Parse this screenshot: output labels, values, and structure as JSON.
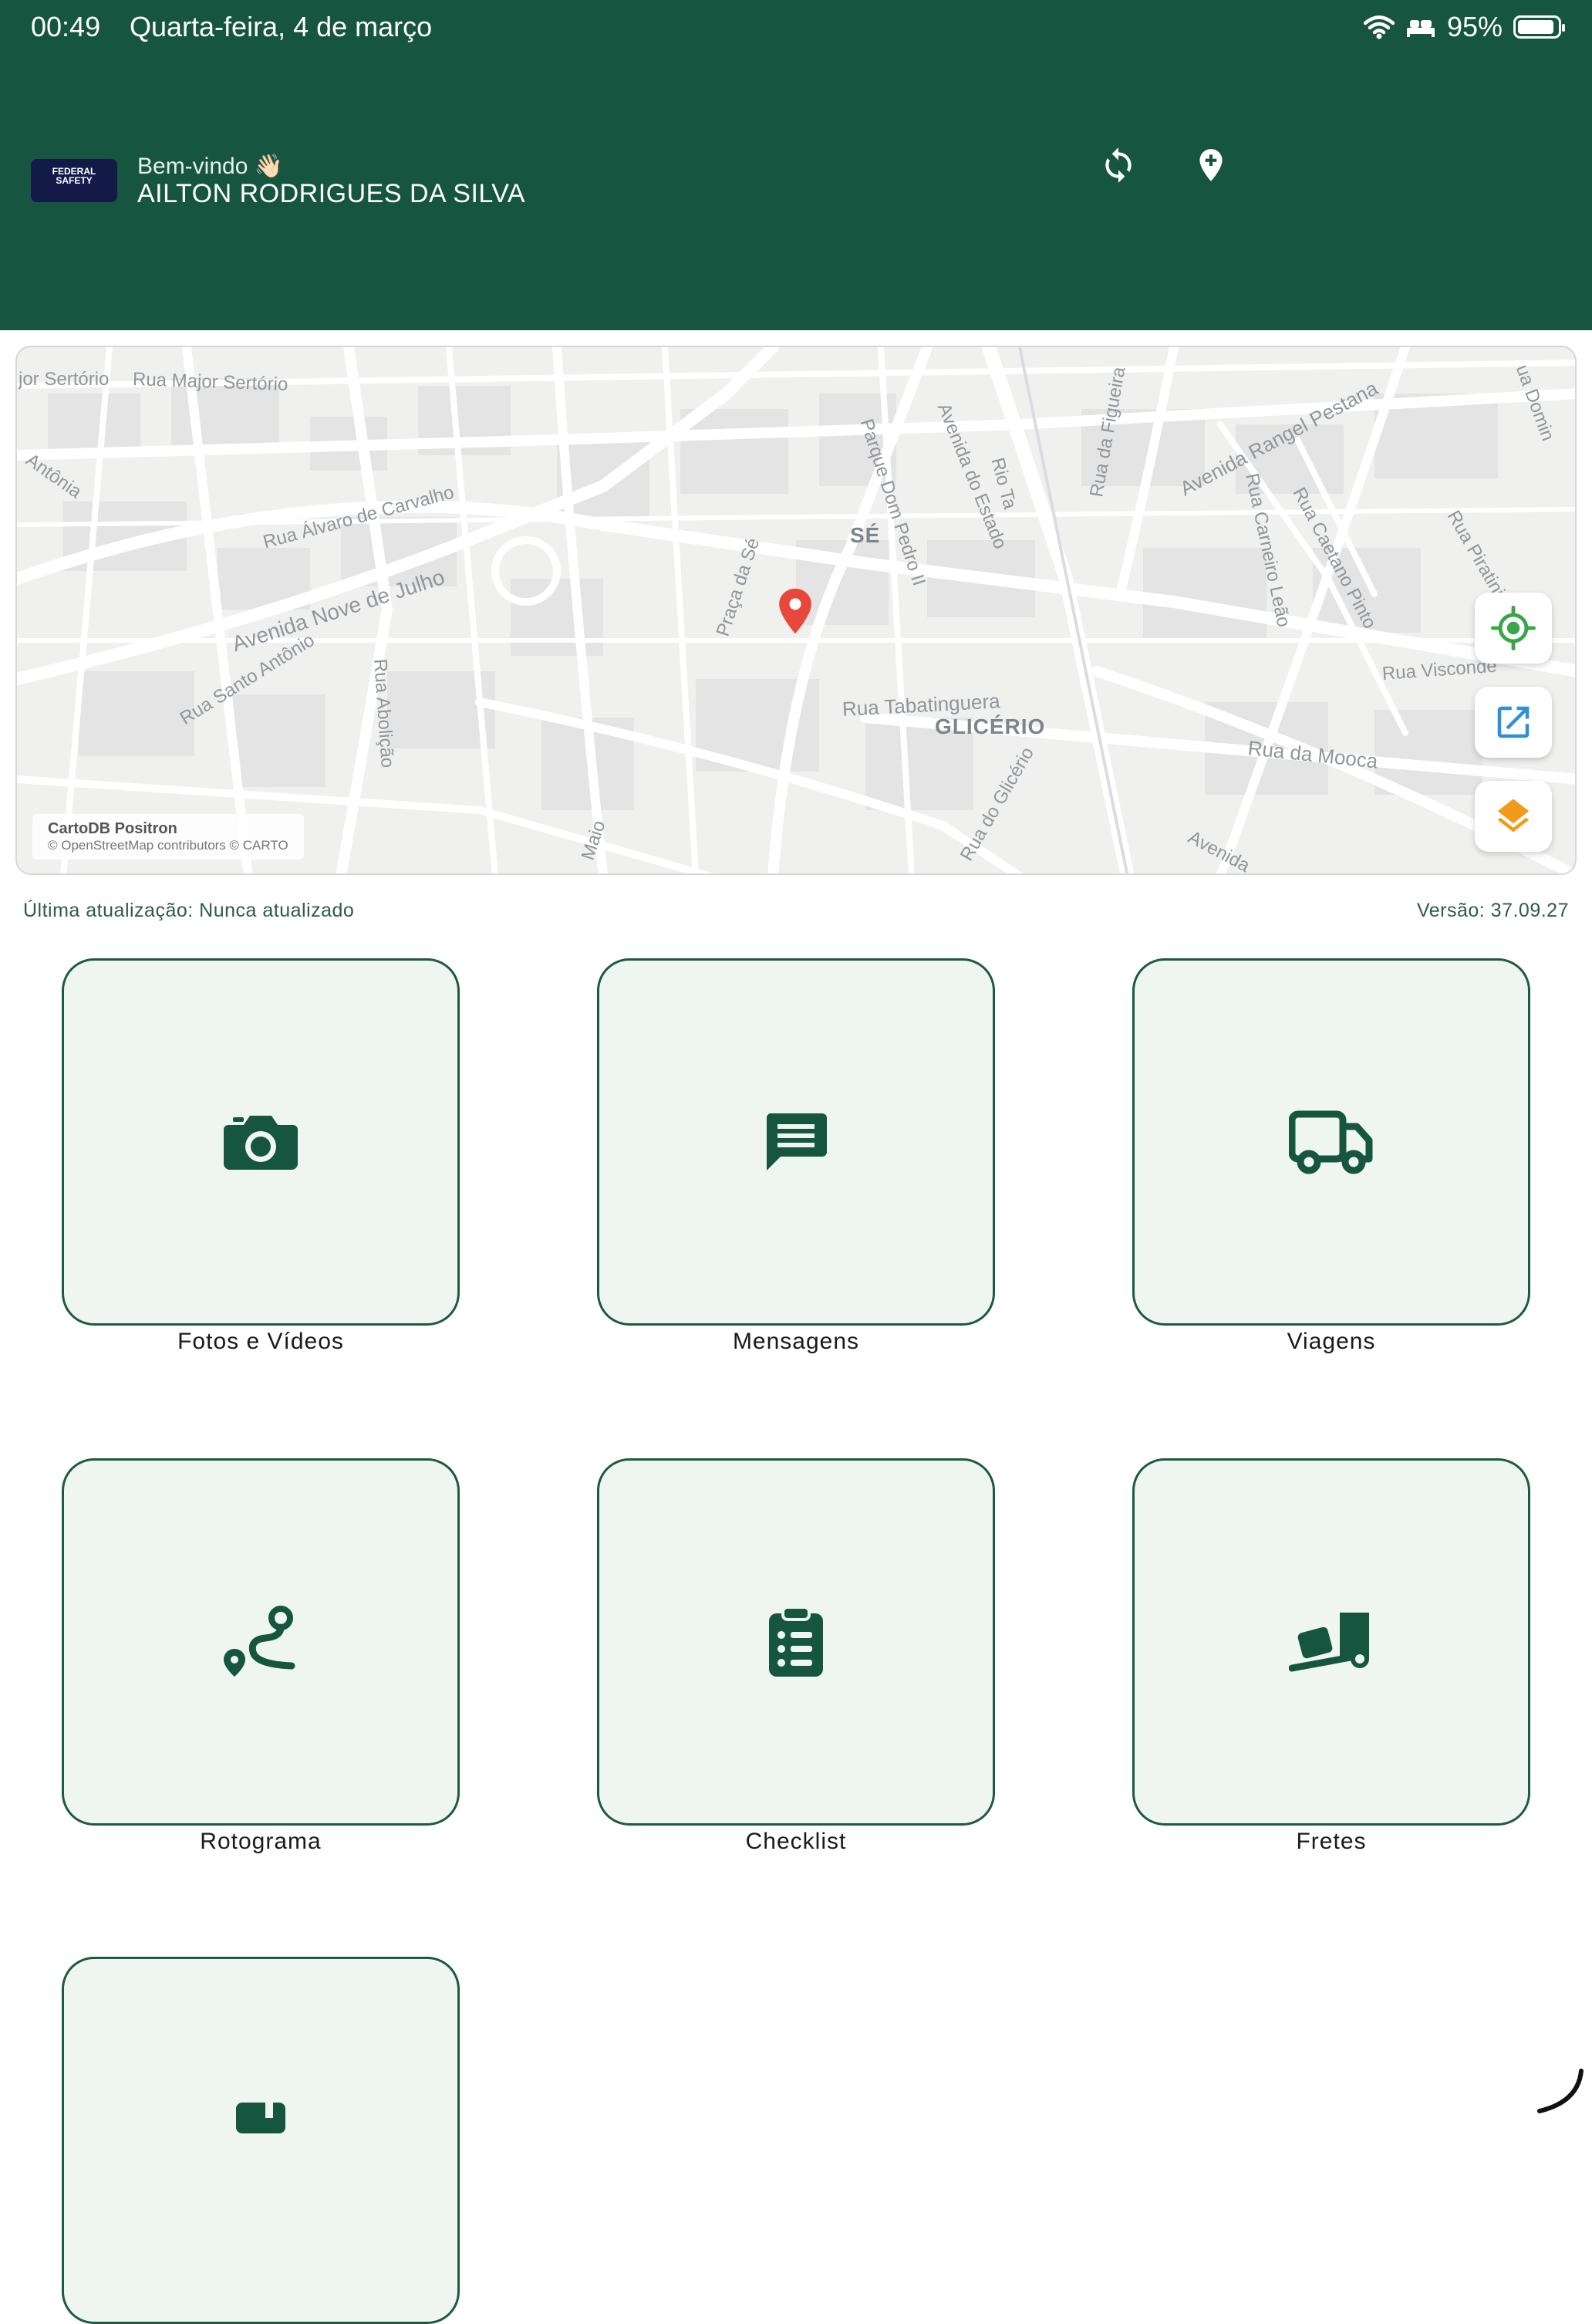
{
  "status_bar": {
    "time": "00:49",
    "date": "Quarta-feira, 4 de março",
    "battery": "95%",
    "battery_level": 0.95
  },
  "header": {
    "logo_text": "FEDERAL SAFETY",
    "greeting": "Bem-vindo 👋🏻",
    "user_name": "AILTON RODRIGUES DA SILVA",
    "actions": [
      {
        "name": "sync",
        "icon": "sync-icon"
      },
      {
        "name": "add-location",
        "icon": "add-location-icon"
      }
    ],
    "background_color": "#165540"
  },
  "map": {
    "streets": [
      "Rua Major Sertório",
      "jor Sertório",
      "Rua Álvaro de Carvalho",
      "Avenida Nove de Julho",
      "Rua Santo Antônio",
      "Rua Abolição",
      "Praça da Sé",
      "Parque Dom Pedro II",
      "Avenida do Estado",
      "Rio Ta",
      "Rua da Figueira",
      "Avenida Rangel Pestana",
      "Rua Carneiro Leão",
      "Rua Caetano Pinto",
      "Rua Piratini",
      "Rua Tabatinguera",
      "Rua da Mooca",
      "Rua Visconde",
      "Rua do Glicério",
      "Avenida",
      "Maio",
      "Antônia",
      "ua Domin"
    ],
    "districts": [
      "SÉ",
      "GLICÉRIO"
    ],
    "attribution_title": "CartoDB Positron",
    "attribution_text": "© OpenStreetMap contributors © CARTO",
    "marker_color": "#e8483c",
    "controls": [
      {
        "name": "my-location",
        "icon": "crosshair-icon",
        "color": "#3aa64a"
      },
      {
        "name": "open-external",
        "icon": "open-in-new-icon",
        "color": "#2f8fd8"
      },
      {
        "name": "layers",
        "icon": "layers-icon",
        "color": "#f29a1a"
      }
    ]
  },
  "info": {
    "last_update": "Última atualização: Nunca atualizado",
    "version": "Versão: 37.09.27"
  },
  "tiles": [
    {
      "label": "Fotos e Vídeos",
      "icon": "camera-icon"
    },
    {
      "label": "Mensagens",
      "icon": "message-icon"
    },
    {
      "label": "Viagens",
      "icon": "truck-icon"
    },
    {
      "label": "Rotograma",
      "icon": "route-icon"
    },
    {
      "label": "Checklist",
      "icon": "clipboard-list-icon"
    },
    {
      "label": "Fretes",
      "icon": "dolly-icon"
    },
    {
      "label": "",
      "icon": "partial-icon"
    }
  ],
  "colors": {
    "primary": "#165540",
    "tile_bg": "#eff6f2",
    "tile_border": "#1c5a44"
  }
}
